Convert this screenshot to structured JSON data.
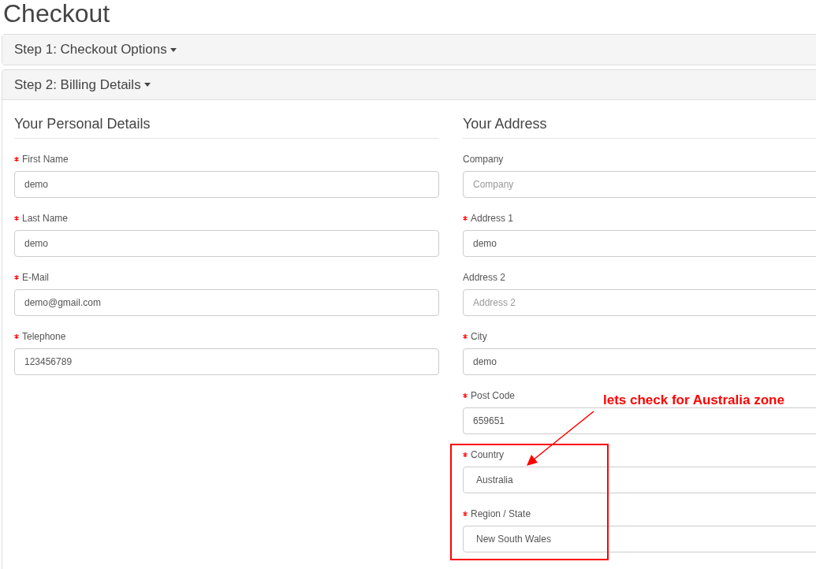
{
  "page_title": "Checkout",
  "steps": [
    {
      "title": "Step 1: Checkout Options",
      "expanded": false
    },
    {
      "title": "Step 2: Billing Details",
      "expanded": true
    }
  ],
  "sections": [
    {
      "heading": "Your Personal Details",
      "fields": [
        {
          "label": "First Name",
          "required": true,
          "kind": "input",
          "value": "demo"
        },
        {
          "label": "Last Name",
          "required": true,
          "kind": "input",
          "value": "demo"
        },
        {
          "label": "E-Mail",
          "required": true,
          "kind": "input",
          "value": "demo@gmail.com"
        },
        {
          "label": "Telephone",
          "required": true,
          "kind": "input",
          "value": "123456789"
        }
      ]
    },
    {
      "heading": "Your Address",
      "fields": [
        {
          "label": "Company",
          "required": false,
          "kind": "input",
          "placeholder": "Company"
        },
        {
          "label": "Address 1",
          "required": true,
          "kind": "input",
          "value": "demo"
        },
        {
          "label": "Address 2",
          "required": false,
          "kind": "input",
          "placeholder": "Address 2"
        },
        {
          "label": "City",
          "required": true,
          "kind": "input",
          "value": "demo"
        },
        {
          "label": "Post Code",
          "required": true,
          "kind": "input",
          "value": "659651"
        },
        {
          "label": "Country",
          "required": true,
          "kind": "select",
          "value": "Australia"
        },
        {
          "label": "Region / State",
          "required": true,
          "kind": "select",
          "value": "New South Wales"
        }
      ]
    }
  ],
  "annotation": {
    "text": "lets check for Australia zone"
  }
}
